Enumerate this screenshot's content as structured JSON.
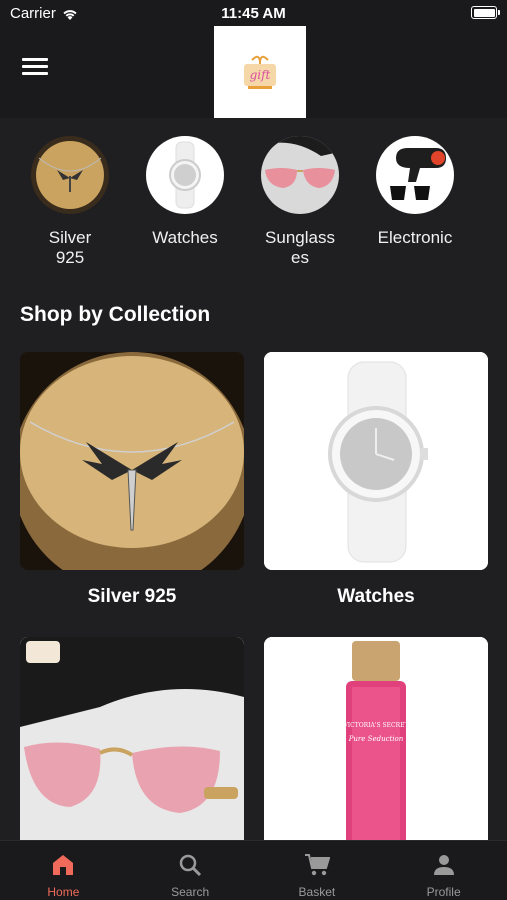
{
  "status": {
    "carrier": "Carrier",
    "time": "11:45 AM"
  },
  "header": {
    "logo_text": "gift"
  },
  "categories": [
    {
      "label": "Silver 925"
    },
    {
      "label": "Watches"
    },
    {
      "label": "Sunglasses"
    },
    {
      "label": "Electronic"
    }
  ],
  "collection": {
    "title": "Shop by Collection",
    "cards": [
      {
        "label": "Silver 925"
      },
      {
        "label": "Watches"
      },
      {
        "label": ""
      },
      {
        "label": ""
      }
    ],
    "perfume_brand": "VICTORIA'S SECRET",
    "perfume_name": "Pure Seduction"
  },
  "tabs": [
    {
      "label": "Home",
      "icon": "home-icon",
      "active": true
    },
    {
      "label": "Search",
      "icon": "search-icon"
    },
    {
      "label": "Basket",
      "icon": "cart-icon"
    },
    {
      "label": "Profile",
      "icon": "profile-icon"
    }
  ],
  "colors": {
    "background": "#1f1f21",
    "bar": "#1a1a1c",
    "accent": "#ef6a5a"
  }
}
